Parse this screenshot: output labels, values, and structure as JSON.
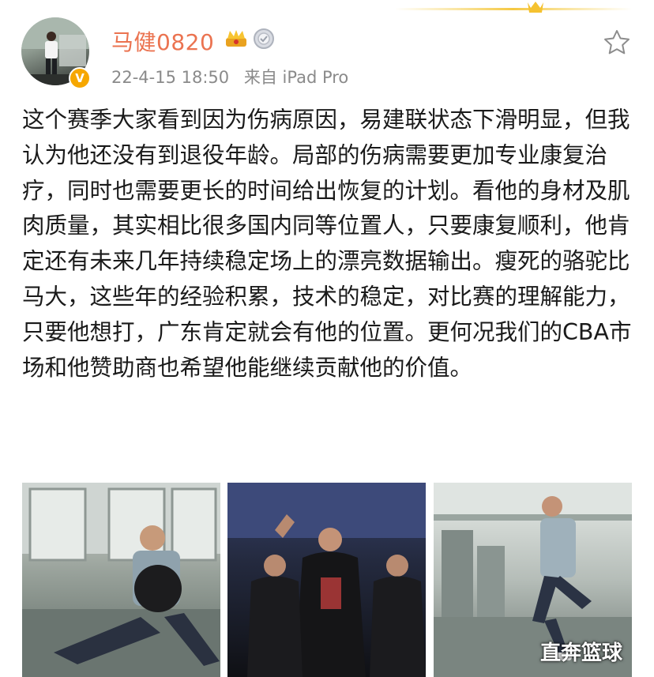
{
  "post": {
    "username": "马健0820",
    "time": "22-4-15 18:50",
    "source": "来自 iPad Pro",
    "text": "这个赛季大家看到因为伤病原因，易建联状态下滑明显，但我认为他还没有到退役年龄。局部的伤病需要更加专业康复治疗，同时也需要更长的时间给出恢复的计划。看他的身材及肌肉质量，其实相比很多国内同等位置人，只要康复顺利，他肯定还有未来几年持续稳定场上的漂亮数据输出。瘦死的骆驼比马大，这些年的经验积累，技术的稳定，对比赛的理解能力，只要他想打，广东肯定就会有他的位置。更何况我们的CBA市场和他赞助商也希望他能继续贡献他的价值。"
  },
  "photos": [
    {
      "icon": "photo-gym-training-ball"
    },
    {
      "icon": "photo-team-huddle"
    },
    {
      "icon": "photo-gym-workout"
    }
  ],
  "watermark": "直奔篮球",
  "colors": {
    "username": "#eb7350",
    "meta": "#8a8a8a",
    "verify": "#f6a700"
  }
}
